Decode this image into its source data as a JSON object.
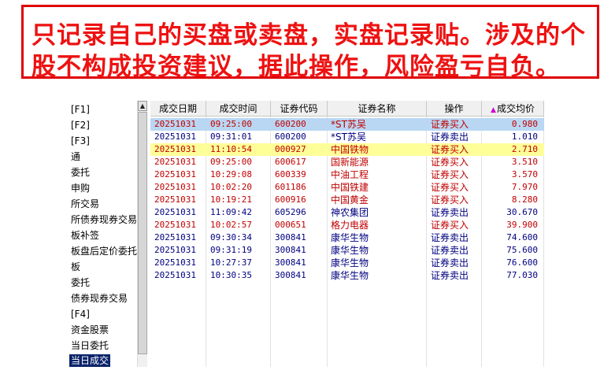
{
  "banner": {
    "line1": "只记录自己的买盘或卖盘，实盘记录贴。涉及的个",
    "line2": "股不构成投资建议，据此操作，风险盈亏自负。"
  },
  "sidebar": {
    "items": [
      {
        "label": "[F1]"
      },
      {
        "label": "[F2]"
      },
      {
        "label": "[F3]"
      },
      {
        "label": "通"
      },
      {
        "label": "委托"
      },
      {
        "label": "申购"
      },
      {
        "label": "所交易"
      },
      {
        "label": "所债券现券交易"
      },
      {
        "label": "板补签"
      },
      {
        "label": "板盘后定价委托"
      },
      {
        "label": "板"
      },
      {
        "label": "委托"
      },
      {
        "label": "债券现券交易"
      },
      {
        "label": "[F4]"
      },
      {
        "label": "资金股票"
      },
      {
        "label": "当日委托"
      },
      {
        "label": "当日成交",
        "selected": true
      }
    ]
  },
  "table": {
    "headers": [
      "成交日期",
      "成交时间",
      "证券代码",
      "证券名称",
      "操作",
      "成交均价"
    ],
    "sort_indicator": "▲",
    "rows": [
      {
        "date": "20251031",
        "time": "09:25:00",
        "code": "600200",
        "name": "*ST苏吴",
        "op": "证券买入",
        "price": "0.980",
        "side": "buy",
        "highlight": "blue"
      },
      {
        "date": "20251031",
        "time": "09:31:01",
        "code": "600200",
        "name": "*ST苏吴",
        "op": "证券卖出",
        "price": "1.010",
        "side": "sell",
        "highlight": ""
      },
      {
        "date": "20251031",
        "time": "11:10:54",
        "code": "000927",
        "name": "中国铁物",
        "op": "证券买入",
        "price": "2.710",
        "side": "buy",
        "highlight": "yellow"
      },
      {
        "date": "20251031",
        "time": "09:25:00",
        "code": "600617",
        "name": "国新能源",
        "op": "证券买入",
        "price": "3.510",
        "side": "buy",
        "highlight": ""
      },
      {
        "date": "20251031",
        "time": "10:29:08",
        "code": "600339",
        "name": "中油工程",
        "op": "证券买入",
        "price": "3.570",
        "side": "buy",
        "highlight": ""
      },
      {
        "date": "20251031",
        "time": "10:02:20",
        "code": "601186",
        "name": "中国铁建",
        "op": "证券买入",
        "price": "7.970",
        "side": "buy",
        "highlight": ""
      },
      {
        "date": "20251031",
        "time": "10:19:21",
        "code": "600916",
        "name": "中国黄金",
        "op": "证券买入",
        "price": "8.280",
        "side": "buy",
        "highlight": ""
      },
      {
        "date": "20251031",
        "time": "11:09:42",
        "code": "605296",
        "name": "神农集团",
        "op": "证券卖出",
        "price": "30.670",
        "side": "sell",
        "highlight": ""
      },
      {
        "date": "20251031",
        "time": "10:02:57",
        "code": "000651",
        "name": "格力电器",
        "op": "证券买入",
        "price": "39.900",
        "side": "buy",
        "highlight": ""
      },
      {
        "date": "20251031",
        "time": "09:30:34",
        "code": "300841",
        "name": "康华生物",
        "op": "证券卖出",
        "price": "74.600",
        "side": "sell",
        "highlight": ""
      },
      {
        "date": "20251031",
        "time": "09:31:19",
        "code": "300841",
        "name": "康华生物",
        "op": "证券卖出",
        "price": "75.600",
        "side": "sell",
        "highlight": ""
      },
      {
        "date": "20251031",
        "time": "10:27:37",
        "code": "300841",
        "name": "康华生物",
        "op": "证券卖出",
        "price": "76.600",
        "side": "sell",
        "highlight": ""
      },
      {
        "date": "20251031",
        "time": "10:30:35",
        "code": "300841",
        "name": "康华生物",
        "op": "证券卖出",
        "price": "77.030",
        "side": "sell",
        "highlight": ""
      }
    ]
  },
  "colors": {
    "banner_red": "#ee1111",
    "buy": "#c00000",
    "sell": "#000080",
    "selected_row": "#b9d7f3",
    "highlight_row": "#ffff99",
    "sidebar_selected": "#0a246a"
  }
}
